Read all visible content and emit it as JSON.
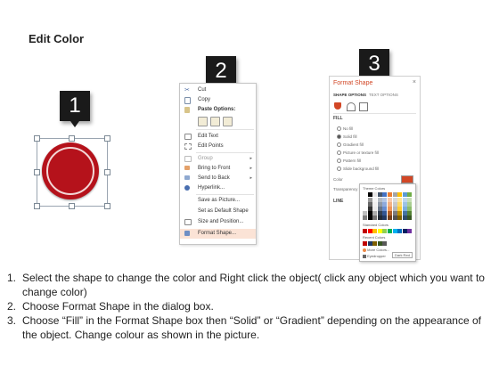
{
  "title": "Edit Color",
  "badges": [
    "1",
    "2",
    "3"
  ],
  "context_menu": {
    "items": [
      {
        "label": "Cut",
        "icon": "scissors-icon"
      },
      {
        "label": "Copy",
        "icon": "copy-icon"
      },
      {
        "label": "Paste Options:",
        "icon": "paste-icon"
      },
      {
        "label": "Edit Text",
        "icon": "edit-text-icon"
      },
      {
        "label": "Edit Points",
        "icon": "edit-points-icon"
      },
      {
        "label": "Group",
        "icon": "group-icon"
      },
      {
        "label": "Bring to Front",
        "icon": "bring-front-icon"
      },
      {
        "label": "Send to Back",
        "icon": "send-back-icon"
      },
      {
        "label": "Hyperlink...",
        "icon": "hyperlink-icon"
      },
      {
        "label": "Save as Picture...",
        "icon": ""
      },
      {
        "label": "Set as Default Shape",
        "icon": ""
      },
      {
        "label": "Size and Position...",
        "icon": "size-position-icon"
      },
      {
        "label": "Format Shape...",
        "icon": "format-shape-icon"
      }
    ]
  },
  "format_pane": {
    "title": "Format Shape",
    "close": "×",
    "tabs": [
      "SHAPE OPTIONS",
      "TEXT OPTIONS"
    ],
    "fill_header": "FILL",
    "fill_options": [
      "No fill",
      "Solid fill",
      "Gradient fill",
      "Picture or texture fill",
      "Pattern fill",
      "Slide background fill"
    ],
    "selected_fill": "Solid fill",
    "color_label": "Color",
    "transparency_label": "Transparency",
    "line_header": "LINE",
    "palette": {
      "theme_label": "Theme Colors",
      "standard_label": "Standard Colors",
      "recent_label": "Recent Colors",
      "more_colors": "More Colors...",
      "eyedropper": "Eyedropper",
      "tooltip": "Dark Red",
      "theme_top": [
        "#ffffff",
        "#000000",
        "#e7e6e6",
        "#44546a",
        "#4472c4",
        "#ed7d31",
        "#a5a5a5",
        "#ffc000",
        "#5b9bd5",
        "#70ad47"
      ],
      "standard": [
        "#c00000",
        "#ff0000",
        "#ffc000",
        "#ffff00",
        "#92d050",
        "#00b050",
        "#00b0f0",
        "#0070c0",
        "#002060",
        "#7030a0"
      ],
      "recent": [
        "#c00000",
        "#1f3864",
        "#7f6000",
        "#375623",
        "#595959"
      ]
    }
  },
  "instructions": [
    {
      "num": "1.",
      "text": "Select the shape to change the color and Right click the object( click any object which you want to change color)"
    },
    {
      "num": "2.",
      "text": "Choose Format Shape in the dialog box."
    },
    {
      "num": "3.",
      "text": "Choose “Fill” in the Format Shape box then “Solid” or “Gradient” depending on the appearance of the object. Change colour as shown in the picture."
    }
  ],
  "colors": {
    "accent": "#d24726",
    "shape_red": "#b5121b",
    "badge_bg": "#1a1a1a"
  }
}
